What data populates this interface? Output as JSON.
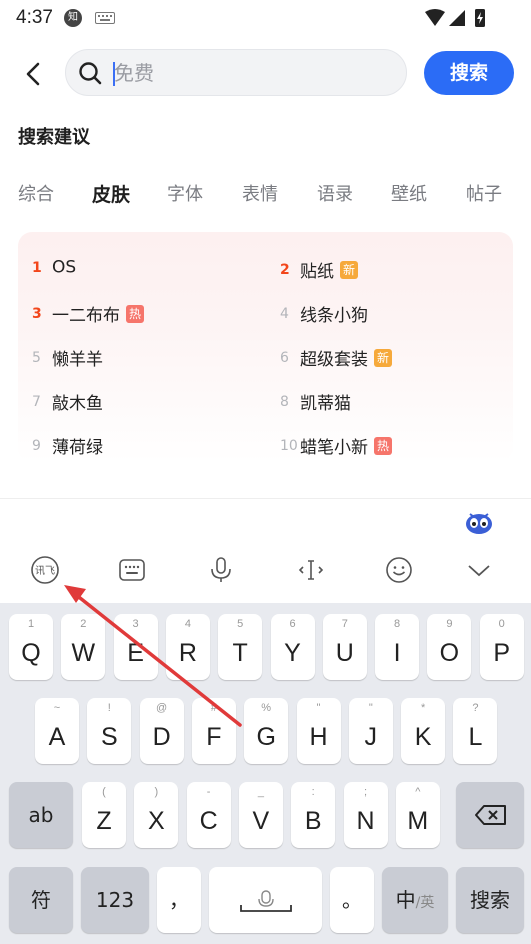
{
  "status_bar": {
    "time": "4:37",
    "app_badge": "知"
  },
  "search": {
    "placeholder": "免费",
    "button_label": "搜索"
  },
  "suggestions": {
    "title": "搜索建议",
    "tabs": [
      "综合",
      "皮肤",
      "字体",
      "表情",
      "语录",
      "壁纸",
      "帖子"
    ],
    "active_tab": "皮肤",
    "items": [
      {
        "rank": "1",
        "text": "OS",
        "badge": ""
      },
      {
        "rank": "2",
        "text": "贴纸",
        "badge": "新"
      },
      {
        "rank": "3",
        "text": "一二布布",
        "badge": "热"
      },
      {
        "rank": "4",
        "text": "线条小狗",
        "badge": ""
      },
      {
        "rank": "5",
        "text": "懒羊羊",
        "badge": ""
      },
      {
        "rank": "6",
        "text": "超级套装",
        "badge": "新"
      },
      {
        "rank": "7",
        "text": "敲木鱼",
        "badge": ""
      },
      {
        "rank": "8",
        "text": "凯蒂猫",
        "badge": ""
      },
      {
        "rank": "9",
        "text": "薄荷绿",
        "badge": ""
      },
      {
        "rank": "10",
        "text": "蜡笔小新",
        "badge": "热"
      }
    ]
  },
  "keyboard": {
    "toolbar_icons": [
      "ime-logo-icon",
      "keyboard-layout-icon",
      "microphone-icon",
      "cursor-move-icon",
      "emoji-icon",
      "collapse-chevron-icon"
    ],
    "rows": [
      [
        {
          "main": "Q",
          "sub": "1"
        },
        {
          "main": "W",
          "sub": "2"
        },
        {
          "main": "E",
          "sub": "3"
        },
        {
          "main": "R",
          "sub": "4"
        },
        {
          "main": "T",
          "sub": "5"
        },
        {
          "main": "Y",
          "sub": "6"
        },
        {
          "main": "U",
          "sub": "7"
        },
        {
          "main": "I",
          "sub": "8"
        },
        {
          "main": "O",
          "sub": "9"
        },
        {
          "main": "P",
          "sub": "0"
        }
      ],
      [
        {
          "main": "A",
          "sub": "~"
        },
        {
          "main": "S",
          "sub": "!"
        },
        {
          "main": "D",
          "sub": "@"
        },
        {
          "main": "F",
          "sub": "#"
        },
        {
          "main": "G",
          "sub": "%"
        },
        {
          "main": "H",
          "sub": "\""
        },
        {
          "main": "J",
          "sub": "\""
        },
        {
          "main": "K",
          "sub": "*"
        },
        {
          "main": "L",
          "sub": "?"
        }
      ],
      [
        {
          "main": "Z",
          "sub": "("
        },
        {
          "main": "X",
          "sub": ")"
        },
        {
          "main": "C",
          "sub": "-"
        },
        {
          "main": "V",
          "sub": "_"
        },
        {
          "main": "B",
          "sub": ":"
        },
        {
          "main": "N",
          "sub": ";"
        },
        {
          "main": "M",
          "sub": "^"
        }
      ]
    ],
    "shift_label": "ab",
    "symbol_label": "符",
    "number_label": "123",
    "comma_label": "，",
    "period_label": "。",
    "lang_label_main": "中",
    "lang_label_sub": "/英",
    "enter_label": "搜索"
  },
  "colors": {
    "accent": "#2b6cf6",
    "hot_rank": "#f2461b",
    "badge_new": "#f6a93b",
    "badge_hot": "#f6756b",
    "annotation_arrow": "#e03a3a"
  }
}
